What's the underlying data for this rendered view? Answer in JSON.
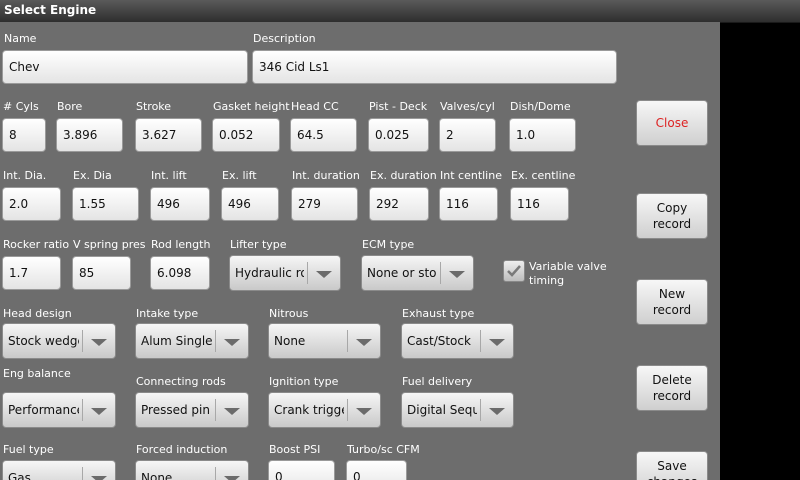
{
  "window": {
    "title": "Select Engine"
  },
  "fields": {
    "name": {
      "label": "Name",
      "value": "Chev"
    },
    "description": {
      "label": "Description",
      "value": "346 Cid Ls1"
    },
    "cyls": {
      "label": "# Cyls",
      "value": "8"
    },
    "bore": {
      "label": "Bore",
      "value": "3.896"
    },
    "stroke": {
      "label": "Stroke",
      "value": "3.627"
    },
    "gasket_height": {
      "label": "Gasket height",
      "value": "0.052"
    },
    "head_cc": {
      "label": "Head CC",
      "value": "64.5"
    },
    "pist_deck": {
      "label": "Pist - Deck",
      "value": "0.025"
    },
    "valves_cyl": {
      "label": "Valves/cyl",
      "value": "2"
    },
    "dish_dome": {
      "label": "Dish/Dome",
      "value": "1.0"
    },
    "int_dia": {
      "label": "Int. Dia.",
      "value": "2.0"
    },
    "ex_dia": {
      "label": "Ex. Dia",
      "value": "1.55"
    },
    "int_lift": {
      "label": "Int. lift",
      "value": "496"
    },
    "ex_lift": {
      "label": "Ex. lift",
      "value": "496"
    },
    "int_duration": {
      "label": "Int. duration",
      "value": "279"
    },
    "ex_duration": {
      "label": "Ex. duration",
      "value": "292"
    },
    "int_centline": {
      "label": "Int centline",
      "value": "116"
    },
    "ex_centline": {
      "label": "Ex. centline",
      "value": "116"
    },
    "rocker_ratio": {
      "label": "Rocker ratio",
      "value": "1.7"
    },
    "v_spring_pres": {
      "label": "V spring pres",
      "value": "85"
    },
    "rod_length": {
      "label": "Rod length",
      "value": "6.098"
    },
    "boost_psi": {
      "label": "Boost PSI",
      "value": "0"
    },
    "turbo_cfm": {
      "label": "Turbo/sc CFM",
      "value": "0"
    }
  },
  "dropdowns": {
    "lifter_type": {
      "label": "Lifter type",
      "value": "Hydraulic ro"
    },
    "ecm_type": {
      "label": "ECM type",
      "value": "None or stoc"
    },
    "head_design": {
      "label": "Head design",
      "value": "Stock wedge"
    },
    "intake_type": {
      "label": "Intake type",
      "value": "Alum Single p"
    },
    "nitrous": {
      "label": "Nitrous",
      "value": "None"
    },
    "exhaust_type": {
      "label": "Exhaust type",
      "value": "Cast/Stock"
    },
    "eng_balance": {
      "label": "Eng balance",
      "value": "Performance"
    },
    "connecting_rods": {
      "label": "Connecting rods",
      "value": "Pressed pin"
    },
    "ignition_type": {
      "label": "Ignition type",
      "value": "Crank trigger"
    },
    "fuel_delivery": {
      "label": "Fuel delivery",
      "value": "Digital Seque"
    },
    "fuel_type": {
      "label": "Fuel type",
      "value": "Gas"
    },
    "forced_induction": {
      "label": "Forced induction",
      "value": "None"
    }
  },
  "variable_valve_timing": {
    "label": "Variable valve timing",
    "checked": true
  },
  "buttons": {
    "close": "Close",
    "copy": "Copy\nrecord",
    "new": "New\nrecord",
    "delete": "Delete\nrecord",
    "save": "Save\nchanges"
  },
  "colors": {
    "background": "#6d6d6d",
    "close_text": "#d22222"
  }
}
